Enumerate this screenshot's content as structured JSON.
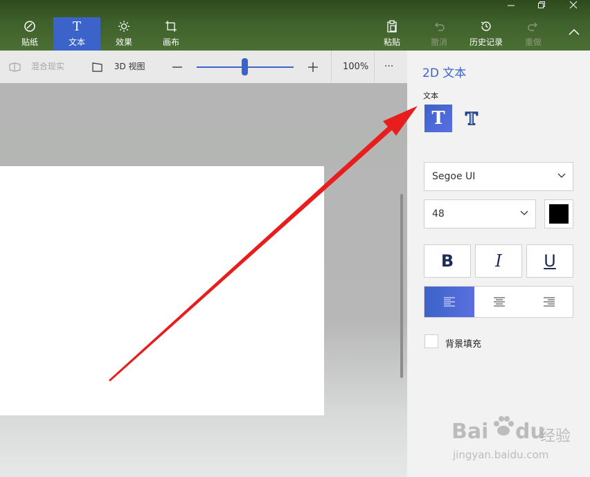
{
  "ribbon": {
    "tools": [
      {
        "label": "贴纸",
        "icon": "sticker-icon"
      },
      {
        "label": "文本",
        "icon": "text-icon"
      },
      {
        "label": "效果",
        "icon": "effects-sun-icon"
      },
      {
        "label": "画布",
        "icon": "canvas-crop-icon"
      }
    ],
    "actions": [
      {
        "label": "粘贴",
        "icon": "paste-icon"
      },
      {
        "label": "撤消",
        "icon": "undo-icon"
      },
      {
        "label": "历史记录",
        "icon": "history-icon"
      },
      {
        "label": "重做",
        "icon": "redo-icon"
      }
    ]
  },
  "subbar": {
    "mixed_reality": "混合现实",
    "view_3d": "3D 视图",
    "zoom": "100%",
    "more": "···",
    "zoom_value": 0.5
  },
  "panel": {
    "title": "2D 文本",
    "section": "文本",
    "font": "Segoe UI",
    "size": "48",
    "bold": "B",
    "italic": "I",
    "underline": "U",
    "background_fill": "背景填充",
    "text_color": "#000000"
  },
  "watermark": {
    "brand": "Bai",
    "brand2": "du",
    "suffix": "经验",
    "url": "jingyan.baidu.com"
  },
  "colors": {
    "accent": "#3b63c9",
    "arrow": "#e81e1e"
  }
}
